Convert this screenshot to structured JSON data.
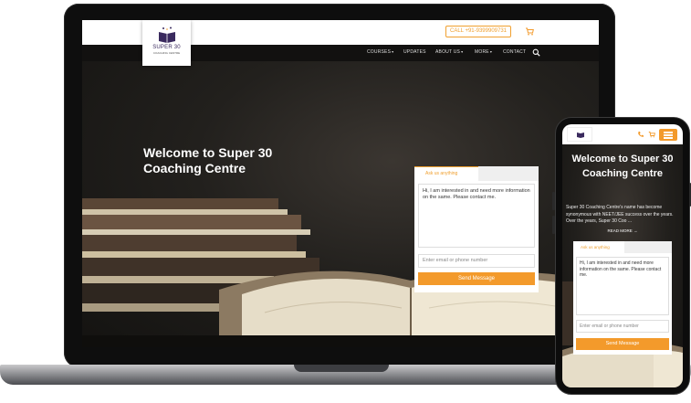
{
  "colors": {
    "accent": "#f39a2b",
    "nav_bg": "#121110",
    "logo_purple": "#3a2a5e",
    "header_bg": "#ffffff"
  },
  "desktop": {
    "logo": {
      "title": "SUPER 30",
      "subtitle": "COACHING CENTRE"
    },
    "header": {
      "call_label": "CALL +91-9399909731",
      "cart_icon": "cart-icon"
    },
    "nav": {
      "items": [
        {
          "label": "COURSES",
          "has_caret": true
        },
        {
          "label": "UPDATES",
          "has_caret": false
        },
        {
          "label": "ABOUT US",
          "has_caret": true
        },
        {
          "label": "MORE",
          "has_caret": true
        },
        {
          "label": "CONTACT",
          "has_caret": false
        }
      ],
      "caret_glyph": "▾",
      "search_icon": "search-icon"
    },
    "hero": {
      "title": "Welcome to Super 30 Coaching Centre"
    },
    "form": {
      "tab_label": "Ask us anything",
      "message": "Hi, I am interested in  and need more information on the same. Please contact me.",
      "contact_placeholder": "Enter email or phone number",
      "send_label": "Send Message"
    }
  },
  "mobile": {
    "header": {
      "phone_icon": "phone-icon",
      "cart_icon": "cart-icon",
      "menu_icon": "hamburger-icon"
    },
    "hero": {
      "title": "Welcome to Super 30 Coaching Centre",
      "description": "Super 30 Coaching Centre's name has become synonymous with NEET/JEE success over the years. Over the years, Super 30 Coo ...",
      "read_more": "READ MORE →"
    },
    "form": {
      "tab_label": "Ask us anything",
      "message": "Hi, I am interested in  and need more information on the same. Please contact me.",
      "contact_placeholder": "Enter email or phone number",
      "send_label": "Send Message"
    }
  }
}
